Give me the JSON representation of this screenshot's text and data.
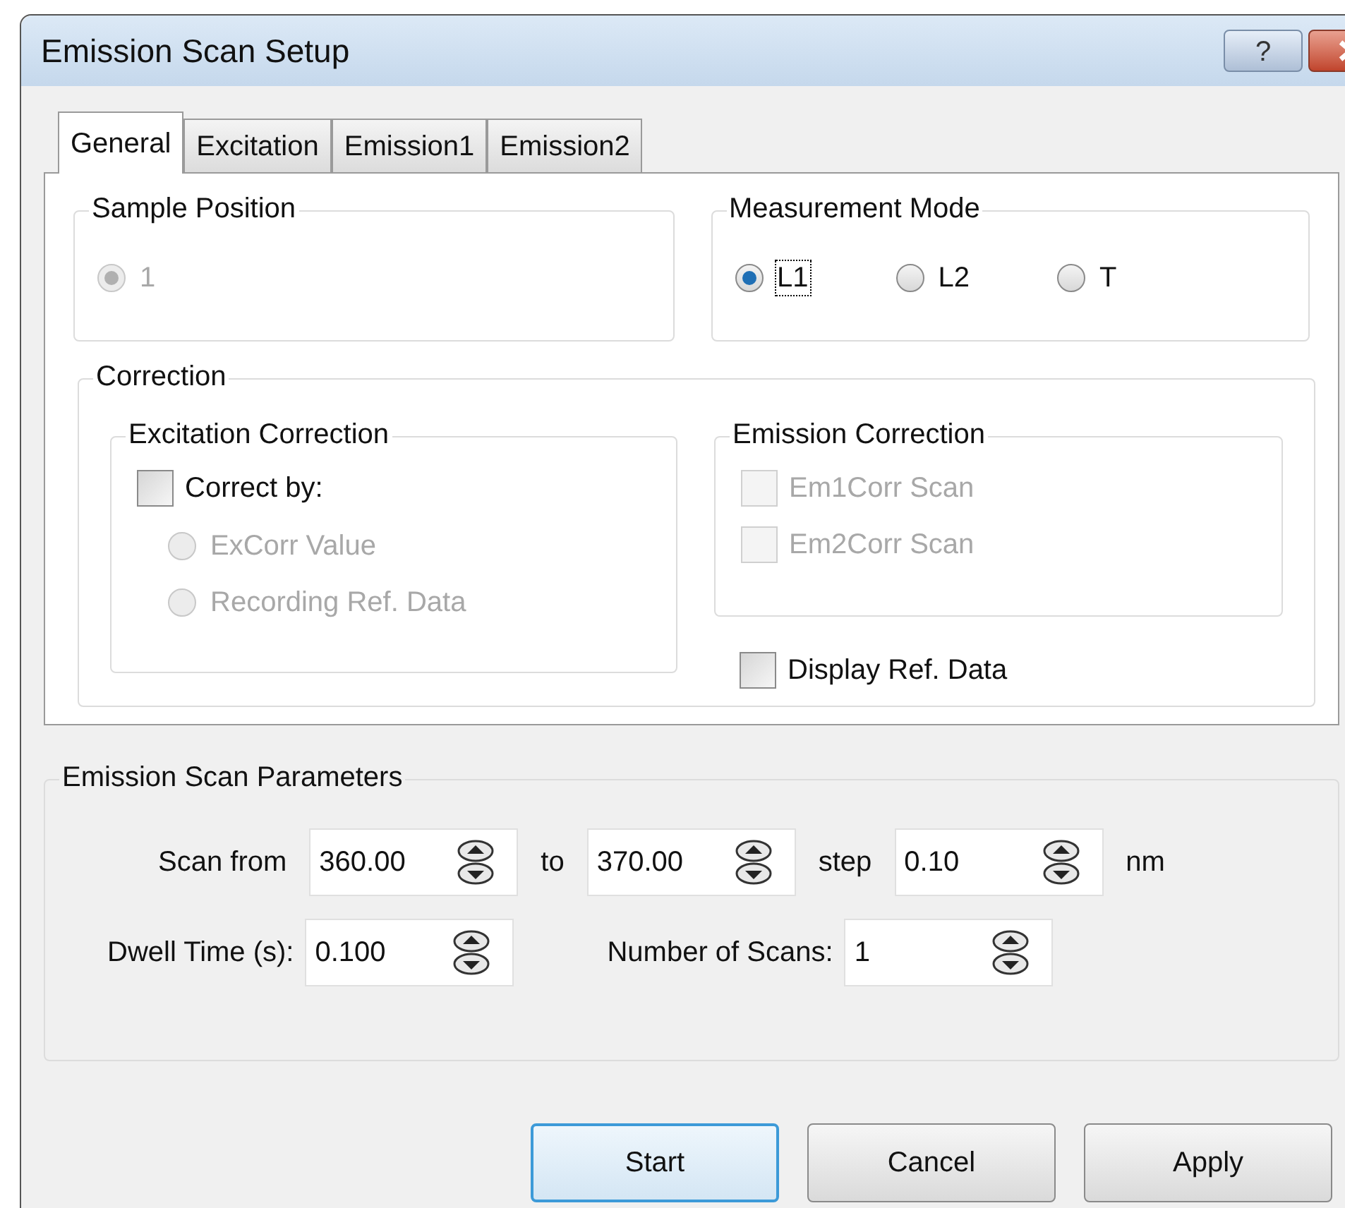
{
  "window": {
    "title": "Emission Scan Setup",
    "help": "?"
  },
  "tabs": [
    {
      "label": "General",
      "selected": true
    },
    {
      "label": "Excitation",
      "selected": false
    },
    {
      "label": "Emission1",
      "selected": false
    },
    {
      "label": "Emission2",
      "selected": false
    }
  ],
  "sample_position": {
    "title": "Sample Position",
    "options": [
      {
        "label": "1",
        "selected": true,
        "disabled": true,
        "focused": false
      }
    ]
  },
  "measurement_mode": {
    "title": "Measurement Mode",
    "options": [
      {
        "label": "L1",
        "selected": true,
        "disabled": false,
        "focused": true
      },
      {
        "label": "L2",
        "selected": false,
        "disabled": false,
        "focused": false
      },
      {
        "label": "T",
        "selected": false,
        "disabled": false,
        "focused": false
      }
    ]
  },
  "correction": {
    "title": "Correction",
    "excitation_correction": {
      "title": "Excitation Correction",
      "correct_by": {
        "label": "Correct by:",
        "checked": false,
        "disabled": false
      },
      "options": [
        {
          "label": "ExCorr Value",
          "selected": false,
          "disabled": true,
          "focused": false
        },
        {
          "label": "Recording Ref. Data",
          "selected": false,
          "disabled": true,
          "focused": false
        }
      ]
    },
    "emission_correction": {
      "title": "Emission Correction",
      "items": [
        {
          "label": "Em1Corr Scan",
          "checked": false,
          "disabled": true
        },
        {
          "label": "Em2Corr Scan",
          "checked": false,
          "disabled": true
        }
      ]
    },
    "display_ref_data": {
      "label": "Display Ref. Data",
      "checked": false,
      "disabled": false
    }
  },
  "parameters": {
    "title": "Emission Scan Parameters",
    "scan_range": {
      "from_label": "Scan from",
      "from": "360.00",
      "to_label": "to",
      "to": "370.00",
      "step_label": "step",
      "step": "0.10",
      "unit": "nm"
    },
    "timing": {
      "dwell_label": "Dwell Time (s):",
      "dwell": "0.100",
      "scans_label": "Number of Scans:",
      "scans": "1"
    }
  },
  "buttons": [
    {
      "label": "Start",
      "default": true
    },
    {
      "label": "Cancel",
      "default": false
    },
    {
      "label": "Apply",
      "default": false
    }
  ]
}
